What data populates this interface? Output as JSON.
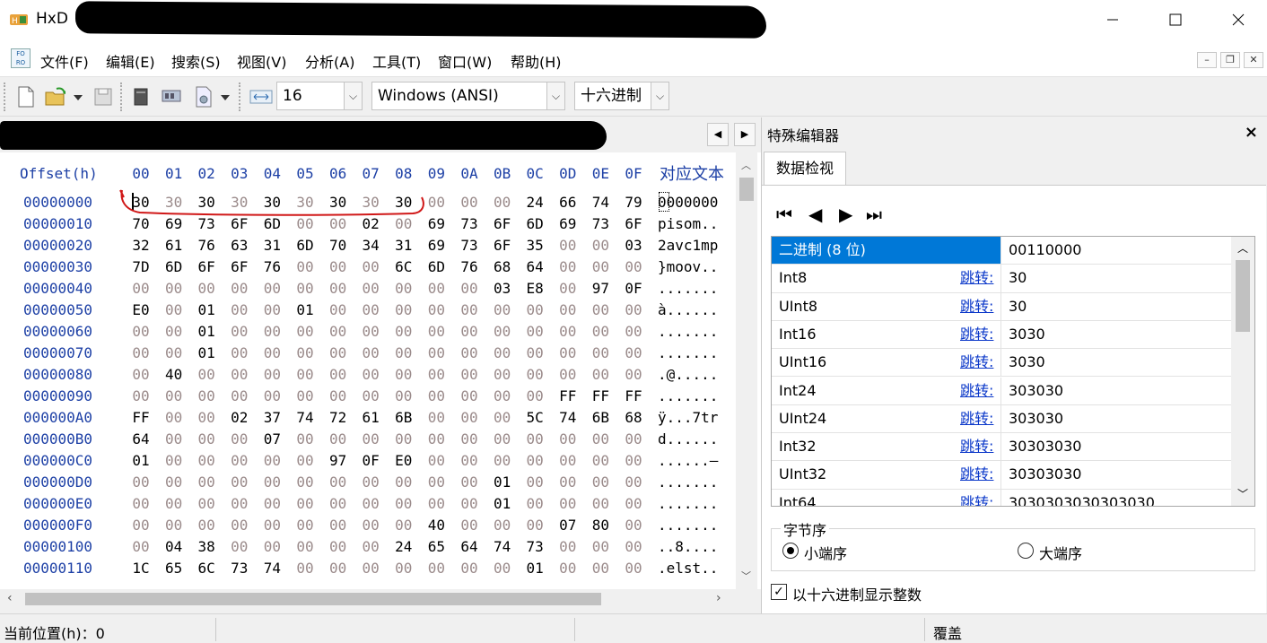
{
  "window": {
    "title": "HxD",
    "controls": [
      "minimize",
      "maximize",
      "close"
    ]
  },
  "menu": {
    "items": [
      "文件(F)",
      "编辑(E)",
      "搜索(S)",
      "视图(V)",
      "分析(A)",
      "工具(T)",
      "窗口(W)",
      "帮助(H)"
    ],
    "icon_text": "FO RO"
  },
  "toolbar": {
    "bytes_per_row": "16",
    "charset": "Windows (ANSI)",
    "offset_base": "十六进制"
  },
  "hex": {
    "offset_header": "Offset(h)",
    "column_headers": [
      "00",
      "01",
      "02",
      "03",
      "04",
      "05",
      "06",
      "07",
      "08",
      "09",
      "0A",
      "0B",
      "0C",
      "0D",
      "0E",
      "0F"
    ],
    "text_header": "对应文本",
    "rows": [
      {
        "offset": "00000000",
        "bytes": [
          "30",
          "30",
          "30",
          "30",
          "30",
          "30",
          "30",
          "30",
          "30",
          "00",
          "00",
          "00",
          "24",
          "66",
          "74",
          "79"
        ],
        "text": "0000000"
      },
      {
        "offset": "00000010",
        "bytes": [
          "70",
          "69",
          "73",
          "6F",
          "6D",
          "00",
          "00",
          "02",
          "00",
          "69",
          "73",
          "6F",
          "6D",
          "69",
          "73",
          "6F"
        ],
        "text": "pisom.."
      },
      {
        "offset": "00000020",
        "bytes": [
          "32",
          "61",
          "76",
          "63",
          "31",
          "6D",
          "70",
          "34",
          "31",
          "69",
          "73",
          "6F",
          "35",
          "00",
          "00",
          "03"
        ],
        "text": "2avc1mp"
      },
      {
        "offset": "00000030",
        "bytes": [
          "7D",
          "6D",
          "6F",
          "6F",
          "76",
          "00",
          "00",
          "00",
          "6C",
          "6D",
          "76",
          "68",
          "64",
          "00",
          "00",
          "00"
        ],
        "text": "}moov.."
      },
      {
        "offset": "00000040",
        "bytes": [
          "00",
          "00",
          "00",
          "00",
          "00",
          "00",
          "00",
          "00",
          "00",
          "00",
          "00",
          "03",
          "E8",
          "00",
          "97",
          "0F"
        ],
        "text": "......."
      },
      {
        "offset": "00000050",
        "bytes": [
          "E0",
          "00",
          "01",
          "00",
          "00",
          "01",
          "00",
          "00",
          "00",
          "00",
          "00",
          "00",
          "00",
          "00",
          "00",
          "00"
        ],
        "text": "à......"
      },
      {
        "offset": "00000060",
        "bytes": [
          "00",
          "00",
          "01",
          "00",
          "00",
          "00",
          "00",
          "00",
          "00",
          "00",
          "00",
          "00",
          "00",
          "00",
          "00",
          "00"
        ],
        "text": "......."
      },
      {
        "offset": "00000070",
        "bytes": [
          "00",
          "00",
          "01",
          "00",
          "00",
          "00",
          "00",
          "00",
          "00",
          "00",
          "00",
          "00",
          "00",
          "00",
          "00",
          "00"
        ],
        "text": "......."
      },
      {
        "offset": "00000080",
        "bytes": [
          "00",
          "40",
          "00",
          "00",
          "00",
          "00",
          "00",
          "00",
          "00",
          "00",
          "00",
          "00",
          "00",
          "00",
          "00",
          "00"
        ],
        "text": ".@....."
      },
      {
        "offset": "00000090",
        "bytes": [
          "00",
          "00",
          "00",
          "00",
          "00",
          "00",
          "00",
          "00",
          "00",
          "00",
          "00",
          "00",
          "00",
          "FF",
          "FF",
          "FF"
        ],
        "text": "......."
      },
      {
        "offset": "000000A0",
        "bytes": [
          "FF",
          "00",
          "00",
          "02",
          "37",
          "74",
          "72",
          "61",
          "6B",
          "00",
          "00",
          "00",
          "5C",
          "74",
          "6B",
          "68"
        ],
        "text": "ÿ...7tr"
      },
      {
        "offset": "000000B0",
        "bytes": [
          "64",
          "00",
          "00",
          "00",
          "07",
          "00",
          "00",
          "00",
          "00",
          "00",
          "00",
          "00",
          "00",
          "00",
          "00",
          "00"
        ],
        "text": "d......"
      },
      {
        "offset": "000000C0",
        "bytes": [
          "01",
          "00",
          "00",
          "00",
          "00",
          "00",
          "97",
          "0F",
          "E0",
          "00",
          "00",
          "00",
          "00",
          "00",
          "00",
          "00"
        ],
        "text": "......—"
      },
      {
        "offset": "000000D0",
        "bytes": [
          "00",
          "00",
          "00",
          "00",
          "00",
          "00",
          "00",
          "00",
          "00",
          "00",
          "00",
          "01",
          "00",
          "00",
          "00",
          "00"
        ],
        "text": "......."
      },
      {
        "offset": "000000E0",
        "bytes": [
          "00",
          "00",
          "00",
          "00",
          "00",
          "00",
          "00",
          "00",
          "00",
          "00",
          "00",
          "01",
          "00",
          "00",
          "00",
          "00"
        ],
        "text": "......."
      },
      {
        "offset": "000000F0",
        "bytes": [
          "00",
          "00",
          "00",
          "00",
          "00",
          "00",
          "00",
          "00",
          "00",
          "40",
          "00",
          "00",
          "00",
          "07",
          "80",
          "00"
        ],
        "text": "......."
      },
      {
        "offset": "00000100",
        "bytes": [
          "00",
          "04",
          "38",
          "00",
          "00",
          "00",
          "00",
          "00",
          "24",
          "65",
          "64",
          "74",
          "73",
          "00",
          "00",
          "00"
        ],
        "text": "..8...."
      },
      {
        "offset": "00000110",
        "bytes": [
          "1C",
          "65",
          "6C",
          "73",
          "74",
          "00",
          "00",
          "00",
          "00",
          "00",
          "00",
          "00",
          "01",
          "00",
          "00",
          "00"
        ],
        "text": ".elst.."
      }
    ]
  },
  "panel": {
    "title": "特殊编辑器",
    "tab": "数据检视",
    "link_label": "跳转:",
    "rows": [
      {
        "name": "二进制 (8 位)",
        "value": "00110000",
        "link": false
      },
      {
        "name": "Int8",
        "value": "30",
        "link": true
      },
      {
        "name": "UInt8",
        "value": "30",
        "link": true
      },
      {
        "name": "Int16",
        "value": "3030",
        "link": true
      },
      {
        "name": "UInt16",
        "value": "3030",
        "link": true
      },
      {
        "name": "Int24",
        "value": "303030",
        "link": true
      },
      {
        "name": "UInt24",
        "value": "303030",
        "link": true
      },
      {
        "name": "Int32",
        "value": "30303030",
        "link": true
      },
      {
        "name": "UInt32",
        "value": "30303030",
        "link": true
      },
      {
        "name": "Int64",
        "value": "3030303030303030",
        "link": true
      }
    ],
    "byte_order_label": "字节序",
    "little_endian": "小端序",
    "big_endian": "大端序",
    "hex_ints_label": "以十六进制显示整数"
  },
  "status": {
    "position": "当前位置(h)：0",
    "mode": "覆盖"
  }
}
